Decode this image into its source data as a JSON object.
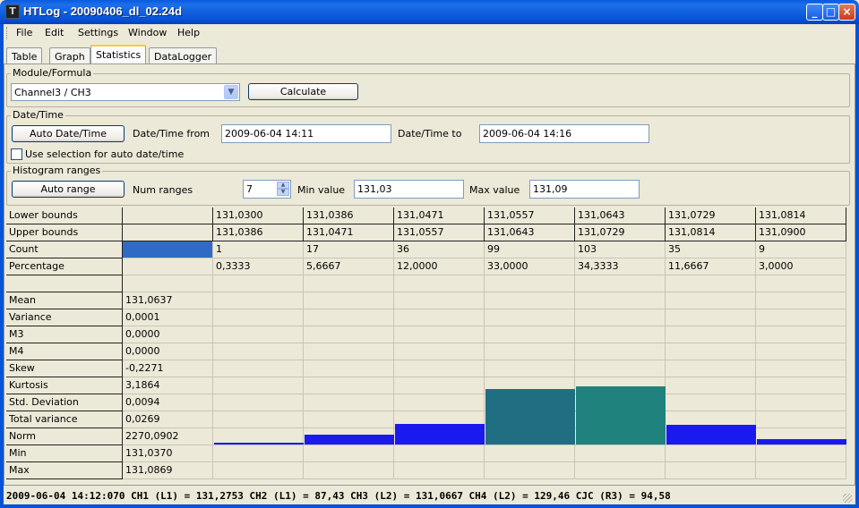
{
  "window": {
    "title": "HTLog - 20090406_dl_02.24d",
    "icon": "app-icon"
  },
  "menu": [
    "File",
    "Edit",
    "Settings",
    "Window",
    "Help"
  ],
  "tabs": [
    {
      "label": "Table"
    },
    {
      "label": "Graph"
    },
    {
      "label": "Statistics",
      "active": true
    },
    {
      "label": "DataLogger"
    }
  ],
  "module": {
    "legend": "Module/Formula",
    "selected": "Channel3 / CH3",
    "calculate": "Calculate"
  },
  "datetime": {
    "legend": "Date/Time",
    "auto_button": "Auto Date/Time",
    "from_label": "Date/Time from",
    "from_value": "2009-06-04 14:11",
    "to_label": "Date/Time to",
    "to_value": "2009-06-04 14:16",
    "use_selection": "Use selection for auto date/time",
    "use_selection_checked": false
  },
  "histogram": {
    "legend": "Histogram ranges",
    "auto_button": "Auto range",
    "num_label": "Num ranges",
    "num_value": "7",
    "min_label": "Min value",
    "min_value": "131,03",
    "max_label": "Max value",
    "max_value": "131,09"
  },
  "table": {
    "lower_label": "Lower bounds",
    "upper_label": "Upper bounds",
    "count_label": "Count",
    "pct_label": "Percentage",
    "lower": [
      "131,0300",
      "131,0386",
      "131,0471",
      "131,0557",
      "131,0643",
      "131,0729",
      "131,0814"
    ],
    "upper": [
      "131,0386",
      "131,0471",
      "131,0557",
      "131,0643",
      "131,0729",
      "131,0814",
      "131,0900"
    ],
    "count": [
      "1",
      "17",
      "36",
      "99",
      "103",
      "35",
      "9"
    ],
    "pct": [
      "0,3333",
      "5,6667",
      "12,0000",
      "33,0000",
      "34,3333",
      "11,6667",
      "3,0000"
    ],
    "stats": [
      {
        "label": "Mean",
        "value": "131,0637"
      },
      {
        "label": "Variance",
        "value": "0,0001"
      },
      {
        "label": "M3",
        "value": "0,0000"
      },
      {
        "label": "M4",
        "value": "0,0000"
      },
      {
        "label": "Skew",
        "value": "-0,2271"
      },
      {
        "label": "Kurtosis",
        "value": "3,1864"
      },
      {
        "label": "Std. Deviation",
        "value": "0,0094"
      },
      {
        "label": "Total variance",
        "value": "0,0269"
      },
      {
        "label": "Norm",
        "value": "2270,0902"
      },
      {
        "label": "Min",
        "value": "131,0370"
      },
      {
        "label": "Max",
        "value": "131,0869"
      }
    ]
  },
  "chart_data": {
    "type": "bar",
    "categories": [
      "131,0300",
      "131,0386",
      "131,0471",
      "131,0557",
      "131,0643",
      "131,0729",
      "131,0814"
    ],
    "values": [
      1,
      17,
      36,
      99,
      103,
      35,
      9
    ],
    "colors": [
      "#1a1aff",
      "#1a1aee",
      "#1a1aee",
      "#1f6e82",
      "#1f827c",
      "#1a1aee",
      "#1a1aee"
    ]
  },
  "status": "2009-06-04 14:12:070 CH1 (L1) = 131,2753 CH2 (L1) = 87,43 CH3 (L2) = 131,0667 CH4 (L2) = 129,46 CJC (R3) = 94,58"
}
